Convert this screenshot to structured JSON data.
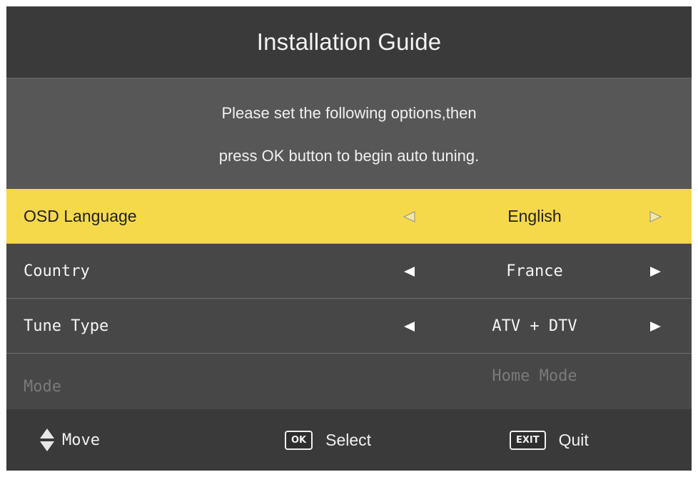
{
  "header": {
    "title": "Installation Guide"
  },
  "instructions": {
    "line1": "Please set the following options,then",
    "line2": "press OK button to begin auto tuning."
  },
  "options": [
    {
      "label": "OSD Language",
      "value": "English",
      "state": "selected"
    },
    {
      "label": "Country",
      "value": "France",
      "state": "normal"
    },
    {
      "label": "Tune Type",
      "value": "ATV + DTV",
      "state": "normal"
    },
    {
      "label": "Mode",
      "value": "Home Mode",
      "state": "disabled"
    }
  ],
  "footer": {
    "move_label": "Move",
    "ok_key": "OK",
    "select_label": "Select",
    "exit_key": "EXIT",
    "quit_label": "Quit"
  },
  "colors": {
    "highlight": "#f5d94a",
    "row_bg": "#474747",
    "panel_bg": "#575757",
    "header_bg": "#3a3a3a"
  },
  "icons": {
    "left": "left-triangle-icon",
    "right": "right-triangle-icon",
    "move": "up-down-arrows-icon"
  }
}
